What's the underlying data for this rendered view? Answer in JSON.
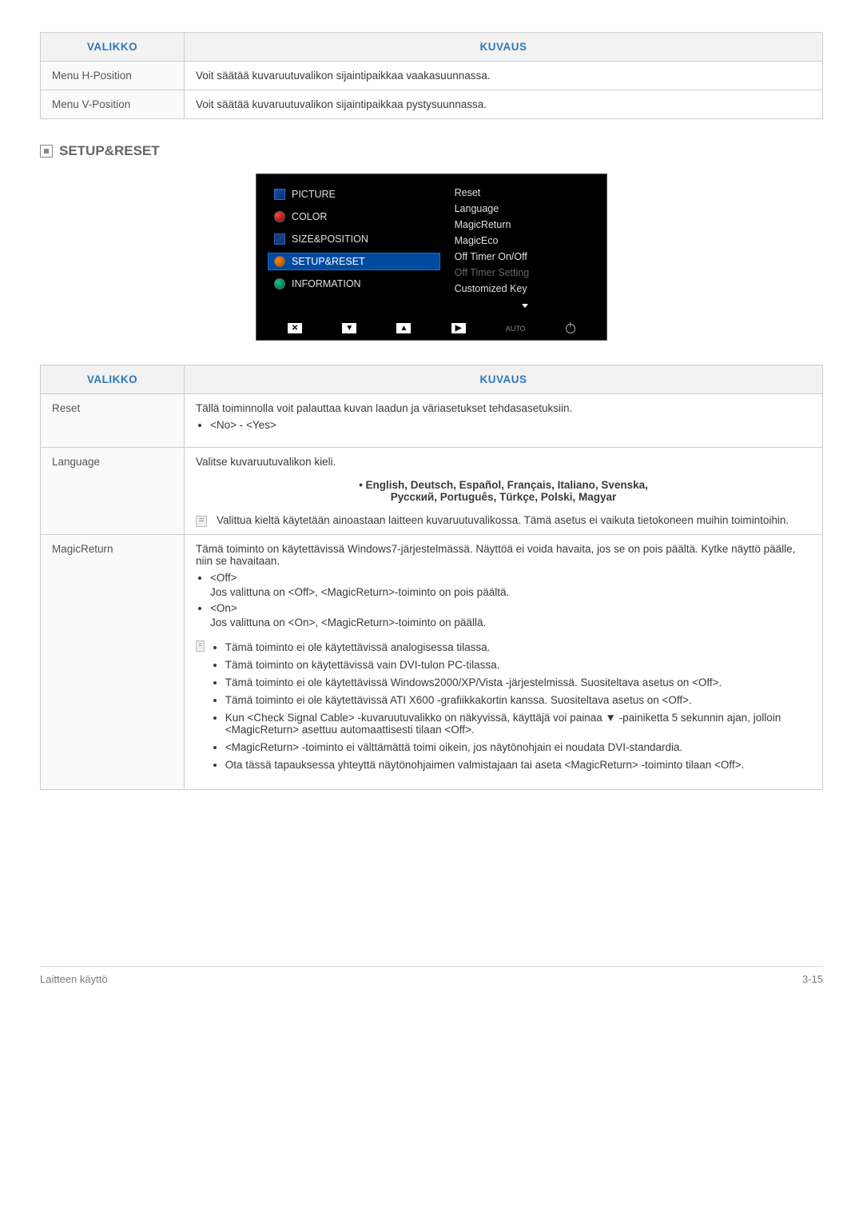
{
  "table1": {
    "headers": {
      "col1": "VALIKKO",
      "col2": "KUVAUS"
    },
    "rows": [
      {
        "menu": "Menu H-Position",
        "desc": "Voit säätää kuvaruutuvalikon sijaintipaikkaa vaakasuunnassa."
      },
      {
        "menu": "Menu V-Position",
        "desc": "Voit säätää kuvaruutuvalikon sijaintipaikkaa pystysuunnassa."
      }
    ]
  },
  "section_heading": "SETUP&RESET",
  "osd": {
    "left": [
      {
        "label": "PICTURE",
        "icon": "pic"
      },
      {
        "label": "COLOR",
        "icon": "col"
      },
      {
        "label": "SIZE&POSITION",
        "icon": "sp"
      },
      {
        "label": "SETUP&RESET",
        "icon": "sr",
        "sel": true
      },
      {
        "label": "INFORMATION",
        "icon": "inf"
      }
    ],
    "right": [
      {
        "label": "Reset"
      },
      {
        "label": "Language"
      },
      {
        "label": "MagicReturn"
      },
      {
        "label": "MagicEco"
      },
      {
        "label": "Off Timer On/Off"
      },
      {
        "label": "Off Timer Setting",
        "dim": true
      },
      {
        "label": "Customized Key"
      }
    ],
    "auto": "AUTO"
  },
  "table2": {
    "headers": {
      "col1": "VALIKKO",
      "col2": "KUVAUS"
    },
    "rows": {
      "reset": {
        "menu": "Reset",
        "line1": "Tällä toiminnolla voit palauttaa kuvan laadun ja väriasetukset tehdasasetuksiin.",
        "bullet": "<No> - <Yes>"
      },
      "language": {
        "menu": "Language",
        "line1": "Valitse kuvaruutuvalikon kieli.",
        "langs1": "• English, Deutsch, Español, Français, Italiano, Svenska,",
        "langs2": "Русский, Português, Türkçe, Polski, Magyar",
        "note": "Valittua kieltä käytetään ainoastaan laitteen kuvaruutuvalikossa. Tämä asetus ei vaikuta tietokoneen muihin toimintoihin."
      },
      "magicreturn": {
        "menu": "MagicReturn",
        "line1": "Tämä toiminto on käytettävissä Windows7-järjestelmässä. Näyttöä ei voida havaita, jos se on pois päältä. Kytke näyttö päälle, niin se havaitaan.",
        "off_label": "<Off>",
        "off_text": "Jos valittuna on <Off>, <MagicReturn>-toiminto on pois päältä.",
        "on_label": "<On>",
        "on_text": "Jos valittuna on <On>, <MagicReturn>-toiminto on päällä.",
        "notes": [
          "Tämä toiminto ei ole käytettävissä analogisessa tilassa.",
          "Tämä toiminto on käytettävissä vain DVI-tulon PC-tilassa.",
          "Tämä toiminto ei ole käytettävissä Windows2000/XP/Vista -järjestelmissä. Suositeltava asetus on <Off>.",
          "Tämä toiminto ei ole käytettävissä ATI X600 -grafiikkakortin kanssa. Suositeltava asetus on <Off>.",
          "Kun <Check Signal Cable> -kuvaruutuvalikko on näkyvissä, käyttäjä voi painaa ▼ -painiketta 5 sekunnin ajan, jolloin <MagicReturn> asettuu automaattisesti tilaan <Off>.",
          "<MagicReturn> -toiminto ei välttämättä toimi oikein, jos näytönohjain ei noudata DVI-standardia.",
          "Ota tässä tapauksessa yhteyttä näytönohjaimen valmistajaan tai aseta <MagicReturn> -toiminto tilaan <Off>."
        ]
      }
    }
  },
  "footer": {
    "left": "Laitteen käyttö",
    "right": "3-15"
  }
}
